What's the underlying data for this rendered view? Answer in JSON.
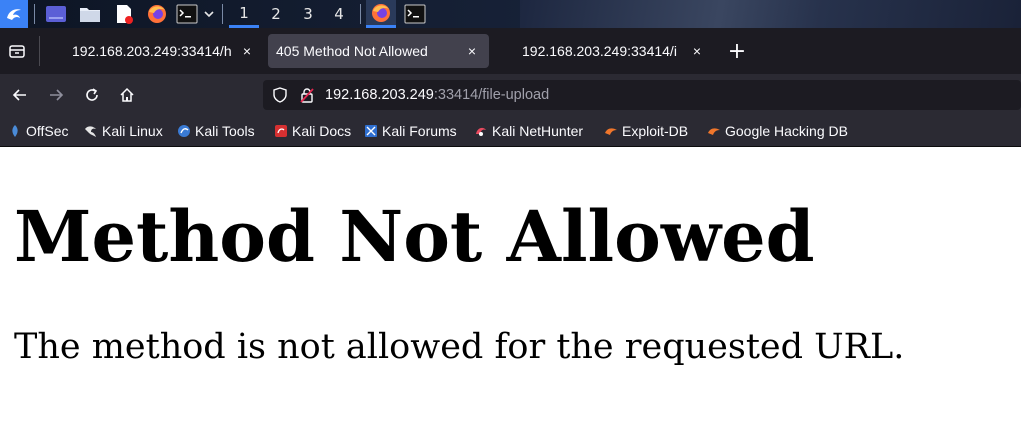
{
  "taskbar": {
    "workspaces": [
      "1",
      "2",
      "3",
      "4"
    ],
    "active_workspace": "1"
  },
  "tabs": [
    {
      "title": "192.168.203.249:33414/h",
      "close": "×"
    },
    {
      "title": "405 Method Not Allowed",
      "close": "×"
    },
    {
      "title": "192.168.203.249:33414/i",
      "close": "×"
    }
  ],
  "new_tab_label": "+",
  "url": {
    "host": "192.168.203.249",
    "rest": ":33414/file-upload"
  },
  "bookmarks": [
    {
      "label": "OffSec",
      "icon": "offsec-icon"
    },
    {
      "label": "Kali Linux",
      "icon": "kali-dragon-icon"
    },
    {
      "label": "Kali Tools",
      "icon": "kali-tools-icon"
    },
    {
      "label": "Kali Docs",
      "icon": "kali-docs-icon"
    },
    {
      "label": "Kali Forums",
      "icon": "kali-forums-icon"
    },
    {
      "label": "Kali NetHunter",
      "icon": "nethunter-icon"
    },
    {
      "label": "Exploit-DB",
      "icon": "exploit-db-icon"
    },
    {
      "label": "Google Hacking DB",
      "icon": "ghdb-icon"
    }
  ],
  "page": {
    "heading": "Method Not Allowed",
    "message": "The method is not allowed for the requested URL."
  },
  "colors": {
    "taskbar_accent": "#3b82f6",
    "tab_strip": "#1c1b22",
    "toolbar": "#2b2a33",
    "active_tab": "#42414d"
  }
}
